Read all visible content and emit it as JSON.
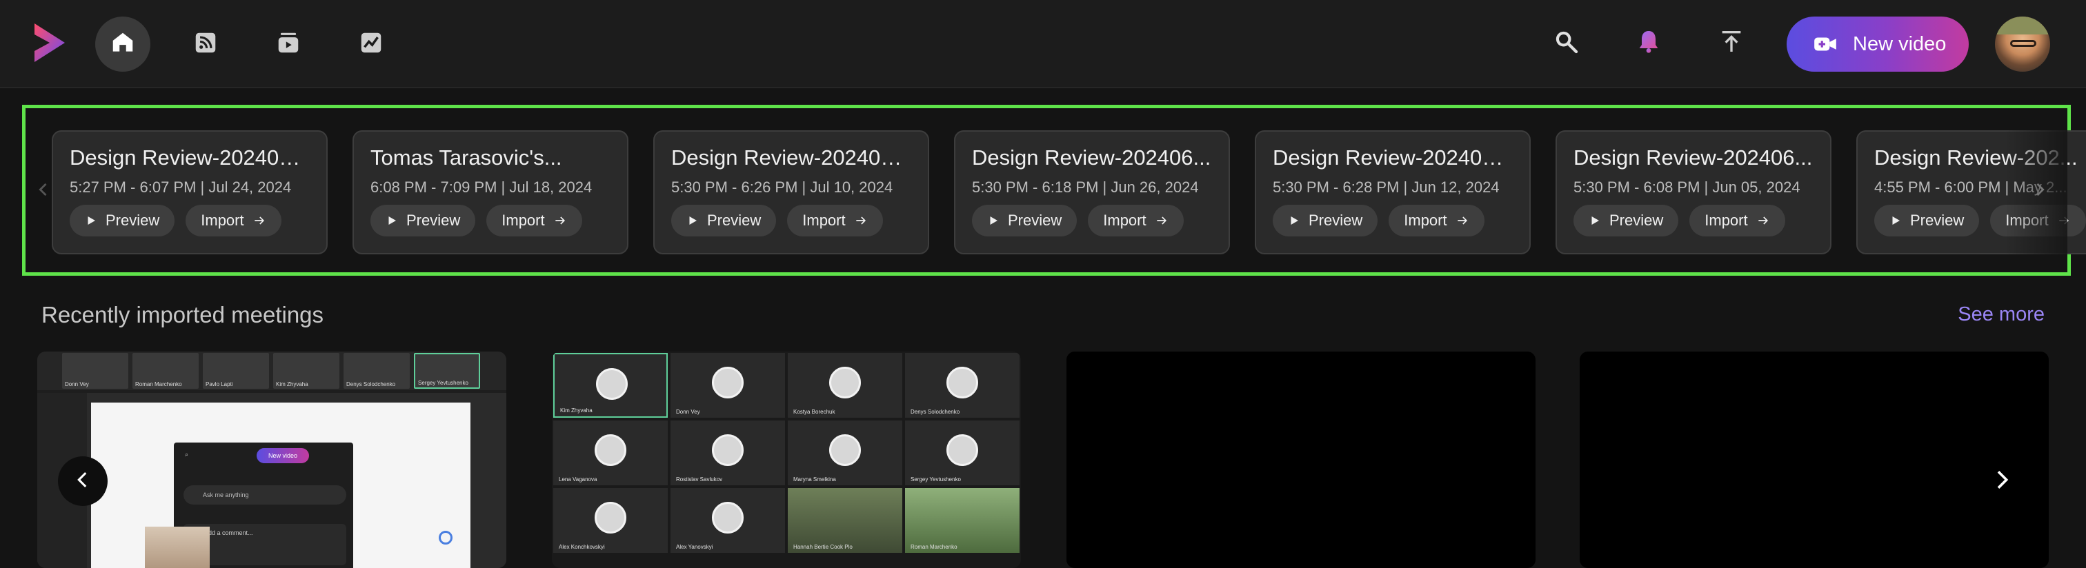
{
  "header": {
    "nav": [
      {
        "name": "home",
        "icon": "home-icon",
        "active": true
      },
      {
        "name": "feed",
        "icon": "rss-icon",
        "active": false
      },
      {
        "name": "library",
        "icon": "video-library-icon",
        "active": false
      },
      {
        "name": "analytics",
        "icon": "chart-icon",
        "active": false
      }
    ],
    "search_icon": "search-icon",
    "notifications_icon": "bell-icon",
    "upload_icon": "upload-icon",
    "new_video_label": "New video",
    "brand_gradient": [
      "#5b4de0",
      "#c23ba0"
    ]
  },
  "meetings_strip": {
    "highlight_color": "#5fe34a",
    "cards": [
      {
        "title": "Design Review-2024072...",
        "subtitle": "5:27 PM - 6:07 PM | Jul 24, 2024",
        "preview": "Preview",
        "import": "Import"
      },
      {
        "title": "Tomas Tarasovic's...",
        "subtitle": "6:08 PM - 7:09 PM | Jul 18, 2024",
        "preview": "Preview",
        "import": "Import"
      },
      {
        "title": "Design Review-2024071...",
        "subtitle": "5:30 PM - 6:26 PM | Jul 10, 2024",
        "preview": "Preview",
        "import": "Import"
      },
      {
        "title": "Design Review-202406...",
        "subtitle": "5:30 PM - 6:18 PM | Jun 26, 2024",
        "preview": "Preview",
        "import": "Import"
      },
      {
        "title": "Design Review-2024061...",
        "subtitle": "5:30 PM - 6:28 PM | Jun 12, 2024",
        "preview": "Preview",
        "import": "Import"
      },
      {
        "title": "Design Review-202406...",
        "subtitle": "5:30 PM - 6:08 PM | Jun 05, 2024",
        "preview": "Preview",
        "import": "Import"
      },
      {
        "title": "Design Review-202...",
        "subtitle": "4:55 PM - 6:00 PM | May 2...",
        "preview": "Preview",
        "import": "Import"
      }
    ]
  },
  "recent": {
    "title": "Recently imported meetings",
    "see_more": "See more",
    "thumb1": {
      "participants": [
        "Donn Vey",
        "Roman Marchenko",
        "Pavlo Lapti",
        "Kim Zhyvaha",
        "Denys Solodchenko",
        "Sergey Yevtushenko"
      ],
      "ask_placeholder": "Ask me anything",
      "add_comment": "Add a comment...",
      "new_video": "New video"
    },
    "thumb2": {
      "participants": [
        "Kim Zhyvaha",
        "Donn Vey",
        "Kostya Borechuk",
        "Denys Solodchenko",
        "Lena Vaganova",
        "Rostislav Savlukov",
        "Maryna Smelkina",
        "Sergey Yevtushenko",
        "Alex Konchkovskyi",
        "Alex Yanovskyi",
        "Hannah Bertie Cook Plo",
        "Roman Marchenko"
      ]
    }
  }
}
